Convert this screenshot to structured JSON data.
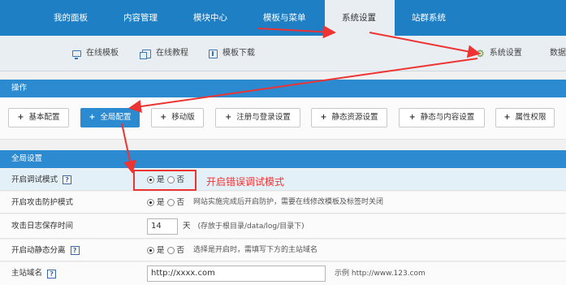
{
  "topnav": [
    "我的面板",
    "内容管理",
    "模块中心",
    "模板与菜单",
    "系统设置",
    "站群系统"
  ],
  "subnav": {
    "online_templates": "在线模板",
    "online_tutorials": "在线教程",
    "template_download": "模板下载",
    "system_settings": "系统设置",
    "data_truncated": "数据"
  },
  "ops_header": "操作",
  "buttons": [
    "基本配置",
    "全局配置",
    "移动版",
    "注册与登录设置",
    "静态资源设置",
    "静态与内容设置",
    "属性权限"
  ],
  "global_header": "全局设置",
  "rows": {
    "debug": {
      "label": "开启调试模式",
      "yes": "是",
      "no": "否"
    },
    "attack": {
      "label": "开启攻击防护模式",
      "yes": "是",
      "no": "否",
      "hint": "网站实施完成后开启防护，需要在线修改模板及标签时关闭"
    },
    "log": {
      "label": "攻击日志保存时间",
      "value": "14",
      "unit": "天",
      "hint": "(存放于根目录/data/log/目录下)"
    },
    "dynamic": {
      "label": "开启动静态分离",
      "yes": "是",
      "no": "否",
      "hint": "选择是开启时，需填写下方的主站域名"
    },
    "domain": {
      "label": "主站域名",
      "value": "http://xxxx.com",
      "hint": "示例 http://www.123.com"
    }
  },
  "help_mark": "?",
  "plus_mark": "+",
  "annotation": "开启错误调试模式",
  "colors": {
    "nav": "#1e7fc4",
    "bar": "#2b8ad0",
    "annotation": "#ee3333"
  }
}
